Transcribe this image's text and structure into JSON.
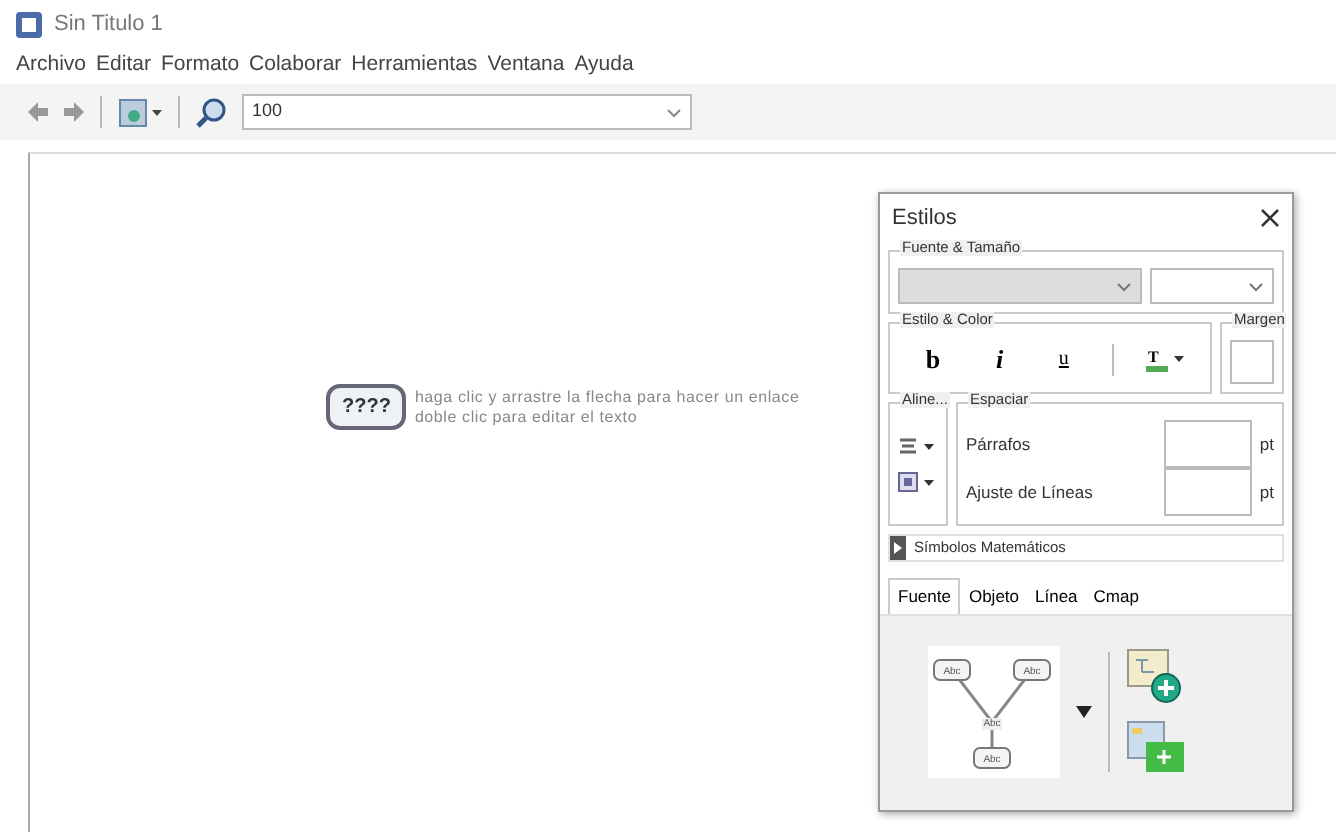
{
  "window": {
    "title": "Sin Titulo 1"
  },
  "menu": [
    "Archivo",
    "Editar",
    "Formato",
    "Colaborar",
    "Herramientas",
    "Ventana",
    "Ayuda"
  ],
  "toolbar": {
    "zoom": "100"
  },
  "canvas": {
    "node": "????",
    "hint": [
      "haga clic y arrastre la flecha para hacer un enlace",
      "doble clic para editar el texto"
    ]
  },
  "styles": {
    "title": "Estilos",
    "font_group": "Fuente & Tamaño",
    "style_group": "Estilo & Color",
    "style_buttons": [
      "b",
      "i",
      "u"
    ],
    "text_color_glyph": "T",
    "margin_group": "Margen",
    "align_group": "Aline...",
    "spacing_group": "Espaciar",
    "spacing_rows": [
      {
        "label": "Párrafos",
        "unit": "pt"
      },
      {
        "label": "Ajuste de Líneas",
        "unit": "pt"
      }
    ],
    "math_symbols": "Símbolos Matemáticos",
    "tabs": [
      {
        "label": "Fuente",
        "selected": true
      },
      {
        "label": "Objeto",
        "selected": false
      },
      {
        "label": "Línea",
        "selected": false
      },
      {
        "label": "Cmap",
        "selected": false
      }
    ],
    "preview_labels": [
      "Abc",
      "Abc",
      "Abc",
      "Abc"
    ]
  }
}
